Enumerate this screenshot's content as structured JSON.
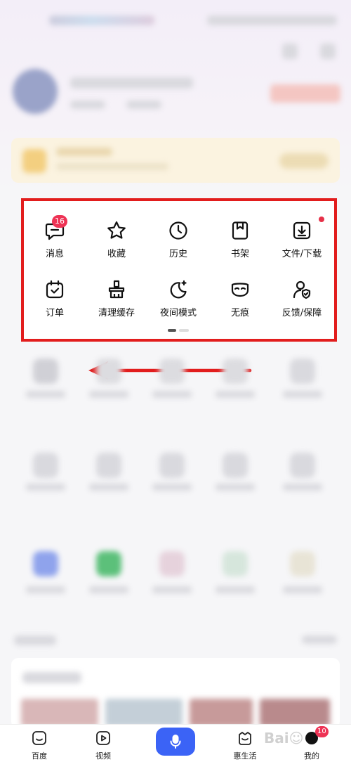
{
  "quick_panel": {
    "row1": [
      {
        "label": "消息",
        "icon": "message-icon",
        "badge": "16"
      },
      {
        "label": "收藏",
        "icon": "star-icon"
      },
      {
        "label": "历史",
        "icon": "clock-icon"
      },
      {
        "label": "书架",
        "icon": "bookshelf-icon"
      },
      {
        "label": "文件/下载",
        "icon": "download-icon",
        "dot": true
      }
    ],
    "row2": [
      {
        "label": "订单",
        "icon": "order-icon"
      },
      {
        "label": "清理缓存",
        "icon": "broom-icon"
      },
      {
        "label": "夜间模式",
        "icon": "moon-icon"
      },
      {
        "label": "无痕",
        "icon": "mask-icon"
      },
      {
        "label": "反馈/保障",
        "icon": "user-shield-icon"
      }
    ]
  },
  "tabbar": {
    "home": "百度",
    "video": "视频",
    "life": "惠生活",
    "mine": "我的",
    "mine_badge": "10",
    "mic_icon": "microphone-icon"
  },
  "colors": {
    "highlight": "#e21d1d",
    "badge": "#ee3355",
    "accent": "#3b63f6"
  }
}
